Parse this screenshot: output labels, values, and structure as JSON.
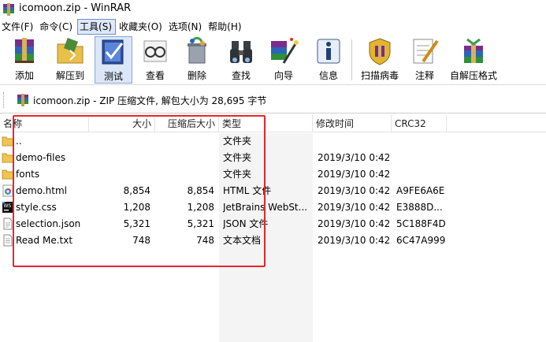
{
  "window": {
    "title": "icomoon.zip - WinRAR"
  },
  "menu": [
    {
      "label": "文件(F)"
    },
    {
      "label": "命令(C)"
    },
    {
      "label": "工具(S)"
    },
    {
      "label": "收藏夹(O)"
    },
    {
      "label": "选项(N)"
    },
    {
      "label": "帮助(H)"
    }
  ],
  "toolbar": {
    "buttons": [
      {
        "label": "添加",
        "icon": "add-books-icon"
      },
      {
        "label": "解压到",
        "icon": "extract-folder-icon"
      },
      {
        "label": "测试",
        "icon": "test-check-icon"
      },
      {
        "label": "查看",
        "icon": "view-glasses-icon"
      },
      {
        "label": "删除",
        "icon": "delete-recycle-icon"
      },
      {
        "label": "查找",
        "icon": "find-binoculars-icon"
      },
      {
        "label": "向导",
        "icon": "wizard-wand-icon"
      },
      {
        "label": "信息",
        "icon": "info-icon"
      },
      {
        "label": "扫描病毒",
        "icon": "scan-virus-icon"
      },
      {
        "label": "注释",
        "icon": "comment-pen-icon"
      },
      {
        "label": "自解压格式",
        "icon": "sfx-box-icon"
      }
    ]
  },
  "pathbar": {
    "text": "icomoon.zip - ZIP 压缩文件, 解包大小为 28,695 字节"
  },
  "columns": {
    "name": "名称",
    "size": "大小",
    "packed": "压缩后大小",
    "type": "类型",
    "modified": "修改时间",
    "crc": "CRC32"
  },
  "files": [
    {
      "name": "..",
      "size": "",
      "packed": "",
      "type": "文件夹",
      "modified": "",
      "crc": "",
      "icon": "folder-icon"
    },
    {
      "name": "demo-files",
      "size": "",
      "packed": "",
      "type": "文件夹",
      "modified": "2019/3/10 0:42",
      "crc": "",
      "icon": "folder-icon"
    },
    {
      "name": "fonts",
      "size": "",
      "packed": "",
      "type": "文件夹",
      "modified": "2019/3/10 0:42",
      "crc": "",
      "icon": "folder-icon"
    },
    {
      "name": "demo.html",
      "size": "8,854",
      "packed": "8,854",
      "type": "HTML 文件",
      "modified": "2019/3/10 0:42",
      "crc": "A9FE6A6E",
      "icon": "html-file-icon"
    },
    {
      "name": "style.css",
      "size": "1,208",
      "packed": "1,208",
      "type": "JetBrains WebSt...",
      "modified": "2019/3/10 0:42",
      "crc": "E3888D...",
      "icon": "webstorm-file-icon"
    },
    {
      "name": "selection.json",
      "size": "5,321",
      "packed": "5,321",
      "type": "JSON 文件",
      "modified": "2019/3/10 0:42",
      "crc": "5C188F4D",
      "icon": "json-file-icon"
    },
    {
      "name": "Read Me.txt",
      "size": "748",
      "packed": "748",
      "type": "文本文档",
      "modified": "2019/3/10 0:42",
      "crc": "6C47A999",
      "icon": "text-file-icon"
    }
  ],
  "colors": {
    "highlight": "#e8262b",
    "active_button_bg": "#dbe6f6"
  }
}
